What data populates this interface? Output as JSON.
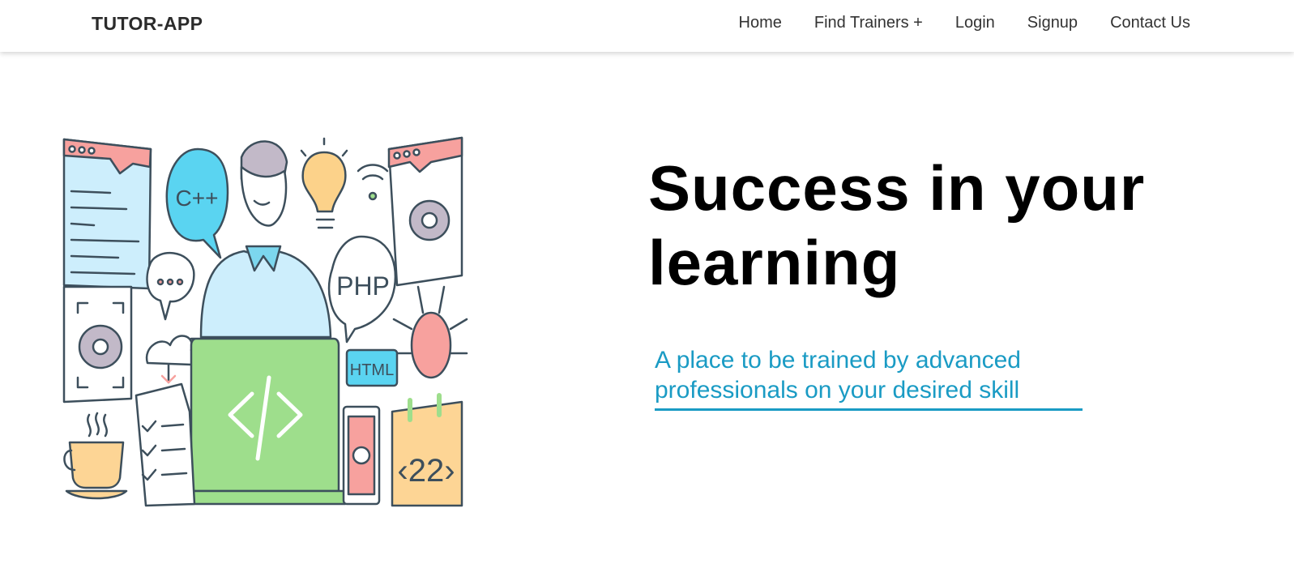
{
  "navbar": {
    "brand": "TUTOR-APP",
    "links": [
      {
        "label": "Home"
      },
      {
        "label": "Find Trainers +"
      },
      {
        "label": "Login"
      },
      {
        "label": "Signup"
      },
      {
        "label": "Contact Us"
      }
    ]
  },
  "hero": {
    "title": "Success in your learning",
    "subtitle": "A place to be trained by advanced professionals on your desired skill",
    "illustration": {
      "labels": {
        "cpp": "C++",
        "php": "PHP",
        "html": "HTML",
        "calendar": "‹22›",
        "code": "</>"
      }
    }
  },
  "colors": {
    "accent": "#1a9bc4",
    "laptop": "#9ede8c",
    "browser_bar": "#f7a19e",
    "browser_panel": "#cdeefc",
    "speech_blue": "#5ad4f1",
    "bulb": "#fcd28a",
    "calendar": "#fdd595"
  }
}
